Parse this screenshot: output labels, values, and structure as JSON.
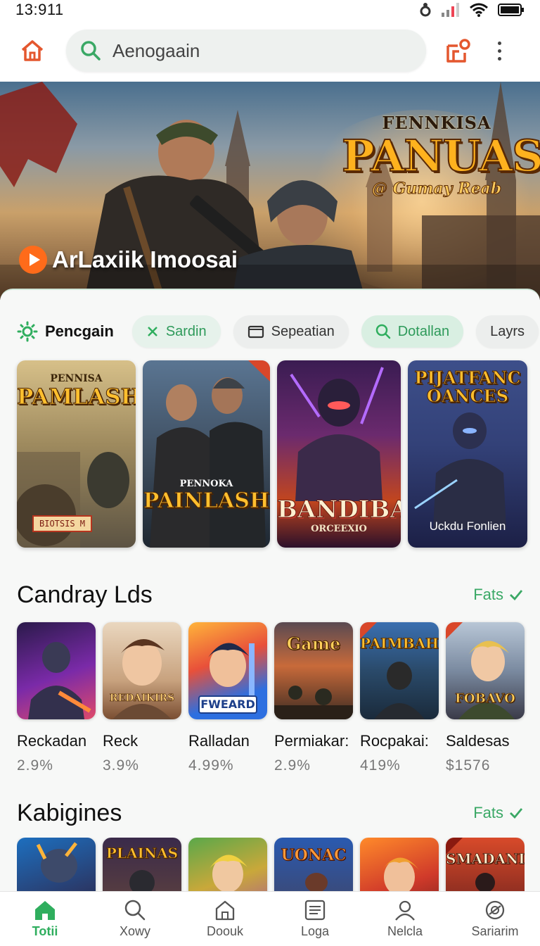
{
  "status": {
    "time": "13:911"
  },
  "topbar": {
    "search_text": "Aenogaain"
  },
  "hero": {
    "sub_top": "FENNKISA",
    "title": "PANUASH",
    "sub_bottom": "@ Gumay Reab",
    "caption": "ArLaxiik Imoosai"
  },
  "filters": {
    "label": "Pencgain",
    "chips": [
      "Sardin",
      "Sepeatian",
      "Dotallan",
      "Layrs"
    ]
  },
  "featured": [
    {
      "title": "PAMLASH",
      "sub": "PENNISA",
      "badge": "BIOTSIS M"
    },
    {
      "title": "PAINLASH",
      "sub": "PENNOKA"
    },
    {
      "title": "BANDIBAI",
      "sub": "ORCEEXIO"
    },
    {
      "title": "PIJATFANC OANCES",
      "sub": "Uckdu Fonlien"
    }
  ],
  "section1": {
    "title": "Candray Lds",
    "link": "Fats",
    "items": [
      {
        "name": "Reckadan",
        "value": "2.9%",
        "cap": ""
      },
      {
        "name": "Reck",
        "value": "3.9%",
        "cap": "REDAIKIRS"
      },
      {
        "name": "Ralladan",
        "value": "4.99%",
        "cap": "FWEARD"
      },
      {
        "name": "Permiakar:",
        "value": "2.9%",
        "cap": "Game"
      },
      {
        "name": "Rocpakai:",
        "value": "419%",
        "cap": "PAIMBAH"
      },
      {
        "name": "Saldesas",
        "value": "$1576",
        "cap": "FOBAVO"
      }
    ]
  },
  "section2": {
    "title": "Kabigines",
    "link": "Fats",
    "items": [
      {
        "cap": ""
      },
      {
        "cap": "PLAINAS"
      },
      {
        "cap": ""
      },
      {
        "cap": "UONAC"
      },
      {
        "cap": ""
      },
      {
        "cap": "SMADANI"
      }
    ]
  },
  "nav": [
    {
      "label": "Totii",
      "icon": "home-icon"
    },
    {
      "label": "Xowy",
      "icon": "search-icon"
    },
    {
      "label": "Doouk",
      "icon": "house-outline-icon"
    },
    {
      "label": "Loga",
      "icon": "document-icon"
    },
    {
      "label": "Nelcla",
      "icon": "profile-icon"
    },
    {
      "label": "Sariarim",
      "icon": "settings-icon"
    }
  ],
  "colors": {
    "accent": "#2fae5e",
    "brand_orange": "#e4572e"
  }
}
